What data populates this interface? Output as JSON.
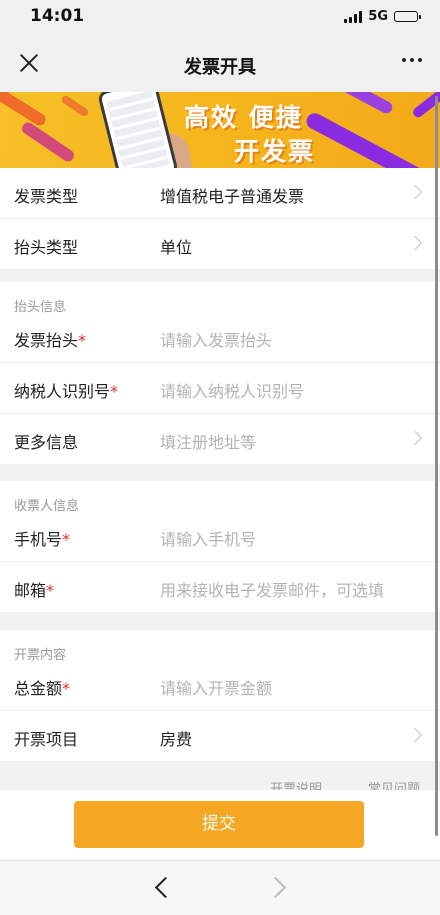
{
  "status_bar": {
    "time": "14:01",
    "network": "5G",
    "battery_level": 0.85
  },
  "nav": {
    "title": "发票开具",
    "close_icon": "close-icon",
    "more_icon": "more-dots-icon"
  },
  "banner": {
    "slogan_line1": "高效 便捷",
    "slogan_line2": "开发票",
    "accent_color": "#8a2be2"
  },
  "invoice_section": {
    "rows": [
      {
        "label": "发票类型",
        "value": "增值税电子普通发票"
      },
      {
        "label": "抬头类型",
        "value": "单位"
      }
    ]
  },
  "title_section": {
    "header": "抬头信息",
    "rows": [
      {
        "label": "发票抬头",
        "required": "*",
        "placeholder": "请输入发票抬头"
      },
      {
        "label": "纳税人识别号",
        "required": "*",
        "placeholder": "请输入纳税人识别号"
      },
      {
        "label": "更多信息",
        "placeholder": "填注册地址等"
      }
    ]
  },
  "receiver_section": {
    "header": "收票人信息",
    "rows": [
      {
        "label": "手机号",
        "required": "*",
        "placeholder": "请输入手机号"
      },
      {
        "label": "邮箱",
        "required": "*",
        "placeholder": "用来接收电子发票邮件，可选填"
      }
    ]
  },
  "content_section": {
    "header": "开票内容",
    "rows": [
      {
        "label": "总金额",
        "required": "*",
        "placeholder": "请输入开票金额"
      },
      {
        "label": "开票项目",
        "value": "房费"
      }
    ]
  },
  "links": {
    "invoice_note": "开票说明",
    "faq": "常见问题"
  },
  "submit": {
    "label": "提交",
    "color": "#f5a623"
  },
  "browser_nav": {
    "back_icon": "chevron-left-icon",
    "forward_icon": "chevron-right-icon"
  }
}
